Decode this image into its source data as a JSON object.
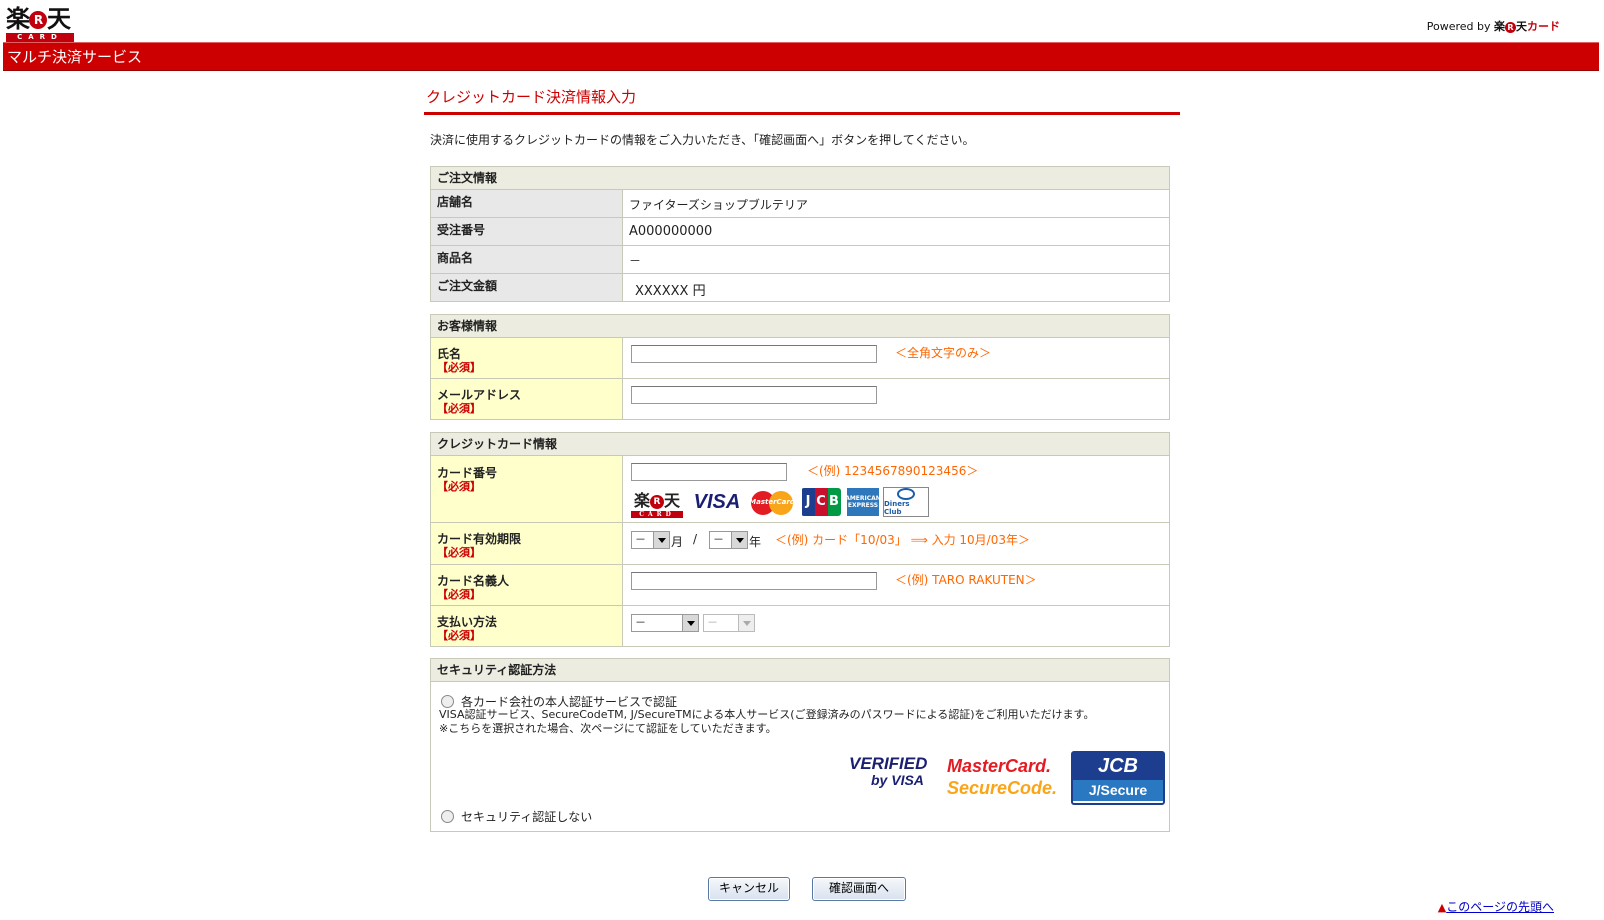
{
  "header": {
    "logo": {
      "kanji_left": "楽",
      "kanji_right": "天",
      "r": "R",
      "sub": "CARD"
    },
    "powered_by": "Powered by",
    "powered_brand_left": "楽",
    "powered_brand_r": "R",
    "powered_brand_right": "天",
    "powered_brand_card": "カード",
    "service_title": "マルチ決済サービス"
  },
  "page": {
    "heading": "クレジットカード決済情報入力",
    "intro": "決済に使用するクレジットカードの情報をご入力いただき、「確認画面へ」ボタンを押してください。"
  },
  "order": {
    "section_title": "ご注文情報",
    "rows": [
      {
        "label": "店舗名",
        "value": "ファイターズショップブルテリア"
      },
      {
        "label": "受注番号",
        "value": "A000000000"
      },
      {
        "label": "商品名",
        "value": "－"
      },
      {
        "label": "ご注文金額",
        "value": "XXXXXX 円"
      }
    ]
  },
  "customer": {
    "section_title": "お客様情報",
    "required": "【必須】",
    "name_label": "氏名",
    "name_hint": "＜全角文字のみ＞",
    "name_value": "",
    "email_label": "メールアドレス",
    "email_value": ""
  },
  "card": {
    "section_title": "クレジットカード情報",
    "required": "【必須】",
    "number_label": "カード番号",
    "number_value": "",
    "number_hint": "＜(例) 1234567890123456＞",
    "brands": {
      "rakuten_left": "楽",
      "rakuten_r": "R",
      "rakuten_right": "天",
      "rakuten_sub": "CARD",
      "visa": "VISA",
      "mastercard": "MasterCard",
      "jcb_j": "J",
      "jcb_c": "C",
      "jcb_b": "B",
      "amex": "AMERICAN EXPRESS",
      "diners": "Diners Club"
    },
    "expiry_label": "カード有効期限",
    "expiry_month": "－",
    "expiry_month_unit": "月",
    "expiry_sep": "/",
    "expiry_year": "－",
    "expiry_year_unit": "年",
    "expiry_hint": "＜(例) カード「10/03」 ⟹ 入力 10月/03年＞",
    "holder_label": "カード名義人",
    "holder_value": "",
    "holder_hint": "＜(例) TARO RAKUTEN＞",
    "payment_label": "支払い方法",
    "payment_method": "－",
    "payment_count": "－"
  },
  "security": {
    "section_title": "セキュリティ認証方法",
    "option1": "各カード会社の本人認証サービスで認証",
    "desc1": "VISA認証サービス、SecureCodeTM, J/SecureTMによる本人サービス(ご登録済みのパスワードによる認証)をご利用いただけます。",
    "desc2": "※こちらを選択された場合、次ページにて認証をしていただきます。",
    "verified_line1": "VERIFIED",
    "verified_line2": "by VISA",
    "mc_line1": "MasterCard.",
    "mc_line2": "SecureCode.",
    "jcb_top": "JCB",
    "jcb_bottom": "J/Secure",
    "option2": "セキュリティ認証しない"
  },
  "actions": {
    "cancel": "キャンセル",
    "confirm": "確認画面へ",
    "page_top_marker": "▲",
    "page_top": "このページの先頭へ"
  },
  "colors": {
    "brand_red": "#cc0000",
    "hint_orange": "#ff6600",
    "required_yellow": "#ffffcc"
  }
}
